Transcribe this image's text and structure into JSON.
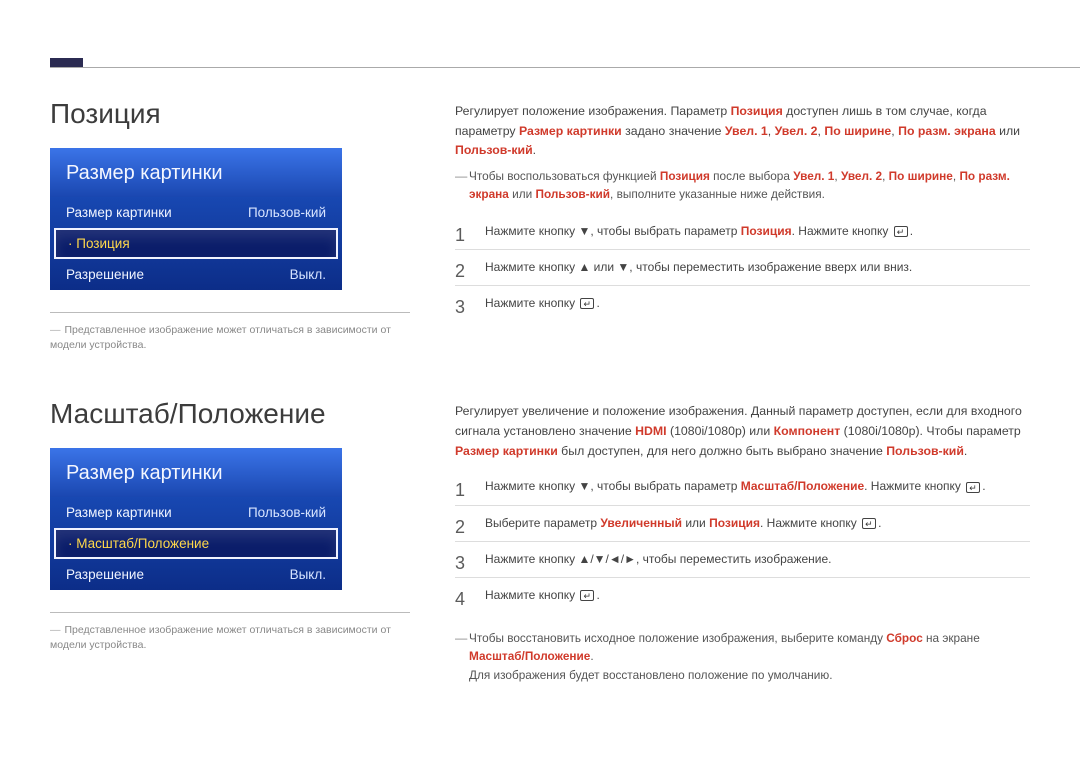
{
  "section1": {
    "title": "Позиция",
    "menu": {
      "title": "Размер картинки",
      "rows": [
        {
          "label": "Размер картинки",
          "value": "Пользов-кий"
        },
        {
          "label": "Позиция",
          "value": ""
        },
        {
          "label": "Разрешение",
          "value": "Выкл."
        }
      ]
    },
    "footnote": "Представленное изображение может отличаться в зависимости от модели устройства.",
    "intro_a": "Регулирует положение изображения. Параметр ",
    "intro_b": " доступен лишь в том случае, когда параметру ",
    "intro_c": " задано значение ",
    "intro_or": " или ",
    "intro_end": ".",
    "kw_position": "Позиция",
    "kw_picsize": "Размер картинки",
    "kw_zoom1": "Увел. 1",
    "kw_zoom2": "Увел. 2",
    "kw_wide": "По ширине",
    "kw_screenfit": "По разм. экрана",
    "kw_custom": "Пользов-кий",
    "note_a": "Чтобы воспользоваться функцией ",
    "note_b": " после выбора ",
    "note_c": ", выполните указанные ниже действия.",
    "steps": {
      "s1_a": "Нажмите кнопку ▼, чтобы выбрать параметр ",
      "s1_b": ". Нажмите кнопку ",
      "s1_c": ".",
      "s2": "Нажмите кнопку ▲ или ▼, чтобы переместить изображение вверх или вниз.",
      "s3_a": "Нажмите кнопку ",
      "s3_b": "."
    }
  },
  "section2": {
    "title": "Масштаб/Положение",
    "menu": {
      "title": "Размер картинки",
      "rows": [
        {
          "label": "Размер картинки",
          "value": "Пользов-кий"
        },
        {
          "label": "Масштаб/Положение",
          "value": ""
        },
        {
          "label": "Разрешение",
          "value": "Выкл."
        }
      ]
    },
    "footnote": "Представленное изображение может отличаться в зависимости от модели устройства.",
    "intro_a": "Регулирует увеличение и положение изображения. Данный параметр доступен, если для входного сигнала установлено значение ",
    "kw_hdmi": "HDMI",
    "intro_b": " (1080i/1080p) или ",
    "kw_comp": "Компонент",
    "intro_c": " (1080i/1080p). Чтобы параметр ",
    "kw_picsize": "Размер картинки",
    "intro_d": " был доступен, для него должно быть выбрано значение ",
    "kw_custom": "Пользов-кий",
    "intro_end": ".",
    "steps": {
      "s1_a": "Нажмите кнопку ▼, чтобы выбрать параметр ",
      "kw_zoompos": "Масштаб/Положение",
      "s1_b": ". Нажмите кнопку ",
      "s1_c": ".",
      "s2_a": "Выберите параметр ",
      "kw_zoomed": "Увеличенный",
      "s2_or": " или ",
      "kw_position": "Позиция",
      "s2_b": ". Нажмите кнопку ",
      "s2_c": ".",
      "s3": "Нажмите кнопку ▲/▼/◄/►, чтобы переместить изображение.",
      "s4_a": "Нажмите кнопку ",
      "s4_b": "."
    },
    "note2_a": "Чтобы восстановить исходное положение изображения, выберите команду ",
    "kw_reset": "Сброс",
    "note2_b": " на экране ",
    "note2_c": ".",
    "note2_d": "Для изображения будет восстановлено положение по умолчанию."
  }
}
